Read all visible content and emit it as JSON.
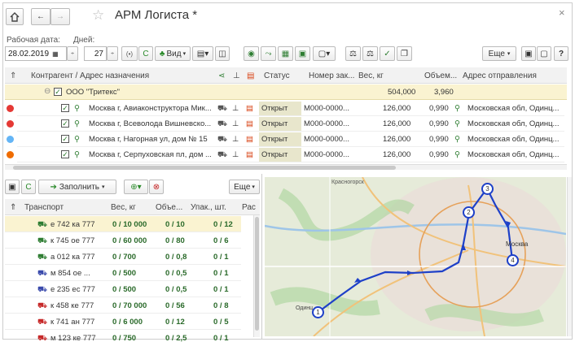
{
  "window": {
    "title": "АРМ Логиста *",
    "close": "×"
  },
  "filters": {
    "work_date_label": "Рабочая дата:",
    "work_date": "28.02.2019",
    "days_label": "Дней:",
    "days": "27",
    "view_label": "Вид",
    "more_label": "Еще",
    "help": "?"
  },
  "top_grid": {
    "headers": {
      "counterparty": "Контрагент / Адрес назначения",
      "status": "Статус",
      "order": "Номер зак...",
      "weight": "Вес, кг",
      "volume": "Объем...",
      "sender": "Адрес отправления"
    },
    "group": {
      "name": "ООО \"Тритекс\"",
      "weight": "504,000",
      "volume": "3,960"
    },
    "rows": [
      {
        "color": "#e53935",
        "address": "Москва г, Авиаконструктора Мик...",
        "status": "Открыт",
        "order": "М000-0000...",
        "weight": "126,000",
        "volume": "0,990",
        "sender": "Московская обл, Одинц..."
      },
      {
        "color": "#e53935",
        "address": "Москва г, Всеволода Вишневско...",
        "status": "Открыт",
        "order": "М000-0000...",
        "weight": "126,000",
        "volume": "0,990",
        "sender": "Московская обл, Одинц..."
      },
      {
        "color": "#64b5f6",
        "address": "Москва г, Нагорная ул, дом № 15",
        "status": "Открыт",
        "order": "М000-0000...",
        "weight": "126,000",
        "volume": "0,990",
        "sender": "Московская обл, Одинц..."
      },
      {
        "color": "#ef6c00",
        "address": "Москва г, Серпуховская пл, дом ...",
        "status": "Открыт",
        "order": "М000-0000...",
        "weight": "126,000",
        "volume": "0,990",
        "sender": "Московская обл, Одинц..."
      }
    ]
  },
  "transport": {
    "fill_label": "Заполнить",
    "more_label": "Еще",
    "headers": {
      "transport": "Транспорт",
      "weight": "Вес, кг",
      "volume": "Объе...",
      "packages": "Упак., шт.",
      "extra": "Рас"
    },
    "rows": [
      {
        "color": "#2e7d32",
        "plate": "е 742 ка 777",
        "weight": "0 / 10 000",
        "volume": "0 / 10",
        "packages": "0 / 12"
      },
      {
        "color": "#2e7d32",
        "plate": "к 745 ое 777",
        "weight": "0 / 60 000",
        "volume": "0 / 80",
        "packages": "0 / 6"
      },
      {
        "color": "#2e7d32",
        "plate": "а 012 ка 777",
        "weight": "0 / 700",
        "volume": "0 / 0,8",
        "packages": "0 / 1"
      },
      {
        "color": "#3949ab",
        "plate": "м 854 ое ...",
        "weight": "0 / 500",
        "volume": "0 / 0,5",
        "packages": "0 / 1"
      },
      {
        "color": "#3949ab",
        "plate": "е 235 ес 777",
        "weight": "0 / 500",
        "volume": "0 / 0,5",
        "packages": "0 / 1"
      },
      {
        "color": "#c62828",
        "plate": "к 458 ке 777",
        "weight": "0 / 70 000",
        "volume": "0 / 56",
        "packages": "0 / 8"
      },
      {
        "color": "#c62828",
        "plate": "к 741 ан 777",
        "weight": "0 / 6 000",
        "volume": "0 / 12",
        "packages": "0 / 5"
      },
      {
        "color": "#c62828",
        "plate": "м 123 ке 777",
        "weight": "0 / 750",
        "volume": "0 / 2,5",
        "packages": "0 / 1"
      }
    ]
  },
  "map": {
    "labels": {
      "krasnogorsk": "Красногорск",
      "moscow": "Москва",
      "odintsovo": "Одинц"
    },
    "points": [
      "1",
      "2",
      "3",
      "4"
    ],
    "route_color": "#1e40c8"
  }
}
